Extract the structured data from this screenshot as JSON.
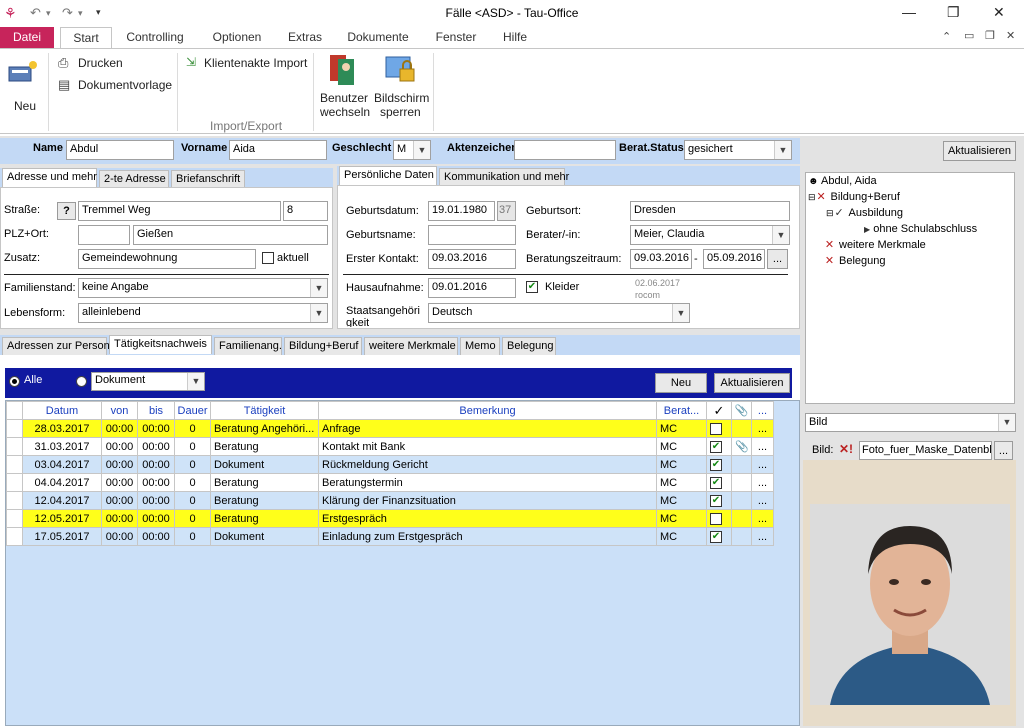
{
  "window": {
    "title": "Fälle <ASD> - Tau-Office",
    "minimize": "—",
    "maximize": "❐",
    "close": "✕"
  },
  "menu": {
    "tabs": [
      "Datei",
      "Start",
      "Controlling",
      "Optionen",
      "Extras",
      "Dokumente",
      "Fenster",
      "Hilfe"
    ]
  },
  "ribbon": {
    "neu": "Neu",
    "drucken": "Drucken",
    "dokumentvorlage": "Dokumentvorlage",
    "klientenakte_import": "Klientenakte Import",
    "benutzer": "Benutzer",
    "wechseln": "wechseln",
    "bildschirm": "Bildschirm",
    "sperren": "sperren",
    "group_import": "Import/Export"
  },
  "header": {
    "name_label": "Name",
    "name": "Abdul",
    "vorname_label": "Vorname",
    "vorname": "Aida",
    "geschlecht_label": "Geschlecht",
    "geschlecht": "M",
    "akten_label": "Aktenzeichen",
    "akten": "",
    "status_label": "Berat.Status",
    "status": "gesichert",
    "aktualisieren": "Aktualisieren"
  },
  "address_tabs": [
    "Adresse und mehr",
    "2-te Adresse",
    "Briefanschrift"
  ],
  "address": {
    "strasse_label": "Straße:",
    "help": "?",
    "strasse": "Tremmel Weg",
    "hausnr": "8",
    "plz_label": "PLZ+Ort:",
    "plz": "",
    "ort": "Gießen",
    "zusatz_label": "Zusatz:",
    "zusatz": "Gemeindewohnung",
    "aktuell": "aktuell",
    "familienstand_label": "Familienstand:",
    "familienstand": "keine Angabe",
    "lebensform_label": "Lebensform:",
    "lebensform": "alleinlebend"
  },
  "personal_tabs": [
    "Persönliche Daten",
    "Kommunikation und mehr"
  ],
  "personal": {
    "geburtsdatum_label": "Geburtsdatum:",
    "geburtsdatum": "19.01.1980",
    "alter": "37",
    "geburtsort_label": "Geburtsort:",
    "geburtsort": "Dresden",
    "geburtsname_label": "Geburtsname:",
    "geburtsname": "",
    "berater_label": "Berater/-in:",
    "berater": "Meier, Claudia",
    "erster_kontakt_label": "Erster Kontakt:",
    "erster_kontakt": "09.03.2016",
    "zeitraum_label": "Beratungszeitraum:",
    "zeitraum_von": "09.03.2016",
    "zeitraum_sep": "-",
    "zeitraum_bis": "05.09.2016",
    "dots": "...",
    "hausaufnahme_label": "Hausaufnahme:",
    "hausaufnahme": "09.01.2016",
    "kleider": "Kleider",
    "stamp_date": "02.06.2017",
    "stamp_user": "rocom",
    "staats_label": "Staatsangehöri",
    "staats_label2": "gkeit",
    "staats": "Deutsch"
  },
  "section_tabs": [
    "Adressen zur Person",
    "Tätigkeitsnachweis",
    "Familienang.",
    "Bildung+Beruf",
    "weitere Merkmale",
    "Memo",
    "Belegung"
  ],
  "activity": {
    "alle": "Alle",
    "filter": "Dokument",
    "neu": "Neu",
    "aktualisieren": "Aktualisieren",
    "columns": [
      "Datum",
      "von",
      "bis",
      "Dauer",
      "Tätigkeit",
      "Bemerkung",
      "Berat...",
      "✓",
      "",
      "..."
    ],
    "rows": [
      {
        "datum": "28.03.2017",
        "von": "00:00",
        "bis": "00:00",
        "dauer": "0",
        "taetigkeit": "Beratung Angehöri...",
        "bemerkung": "Anfrage",
        "berat": "MC",
        "done": false,
        "attach": "",
        "more": "...",
        "hl": "Y"
      },
      {
        "datum": "31.03.2017",
        "von": "00:00",
        "bis": "00:00",
        "dauer": "0",
        "taetigkeit": "Beratung",
        "bemerkung": "Kontakt mit Bank",
        "berat": "MC",
        "done": true,
        "attach": "📎",
        "more": "...",
        "hl": "W"
      },
      {
        "datum": "03.04.2017",
        "von": "00:00",
        "bis": "00:00",
        "dauer": "0",
        "taetigkeit": "Dokument",
        "bemerkung": "Rückmeldung Gericht",
        "berat": "MC",
        "done": true,
        "attach": "",
        "more": "...",
        "hl": "B"
      },
      {
        "datum": "04.04.2017",
        "von": "00:00",
        "bis": "00:00",
        "dauer": "0",
        "taetigkeit": "Beratung",
        "bemerkung": "Beratungstermin",
        "berat": "MC",
        "done": true,
        "attach": "",
        "more": "...",
        "hl": "W"
      },
      {
        "datum": "12.04.2017",
        "von": "00:00",
        "bis": "00:00",
        "dauer": "0",
        "taetigkeit": "Beratung",
        "bemerkung": "Klärung der Finanzsituation",
        "berat": "MC",
        "done": true,
        "attach": "",
        "more": "...",
        "hl": "B"
      },
      {
        "datum": "12.05.2017",
        "von": "00:00",
        "bis": "00:00",
        "dauer": "0",
        "taetigkeit": "Beratung",
        "bemerkung": "Erstgespräch",
        "berat": "MC",
        "done": false,
        "attach": "",
        "more": "...",
        "hl": "Y"
      },
      {
        "datum": "17.05.2017",
        "von": "00:00",
        "bis": "00:00",
        "dauer": "0",
        "taetigkeit": "Dokument",
        "bemerkung": "Einladung zum Erstgespräch",
        "berat": "MC",
        "done": true,
        "attach": "",
        "more": "...",
        "hl": "B"
      }
    ]
  },
  "tree": {
    "root": "Abdul, Aida",
    "n1": "Bildung+Beruf",
    "n2": "Ausbildung",
    "n3": "ohne Schulabschluss",
    "n4": "weitere Merkmale",
    "n5": "Belegung"
  },
  "bild": {
    "select": "Bild",
    "label": "Bild:",
    "file": "Foto_fuer_Maske_Datenbla",
    "dots": "..."
  },
  "colors": {
    "datei": "#c7245b",
    "header_blue": "#c3d9f5",
    "dark_blue": "#1019a0",
    "highlight": "#ffff1a"
  }
}
